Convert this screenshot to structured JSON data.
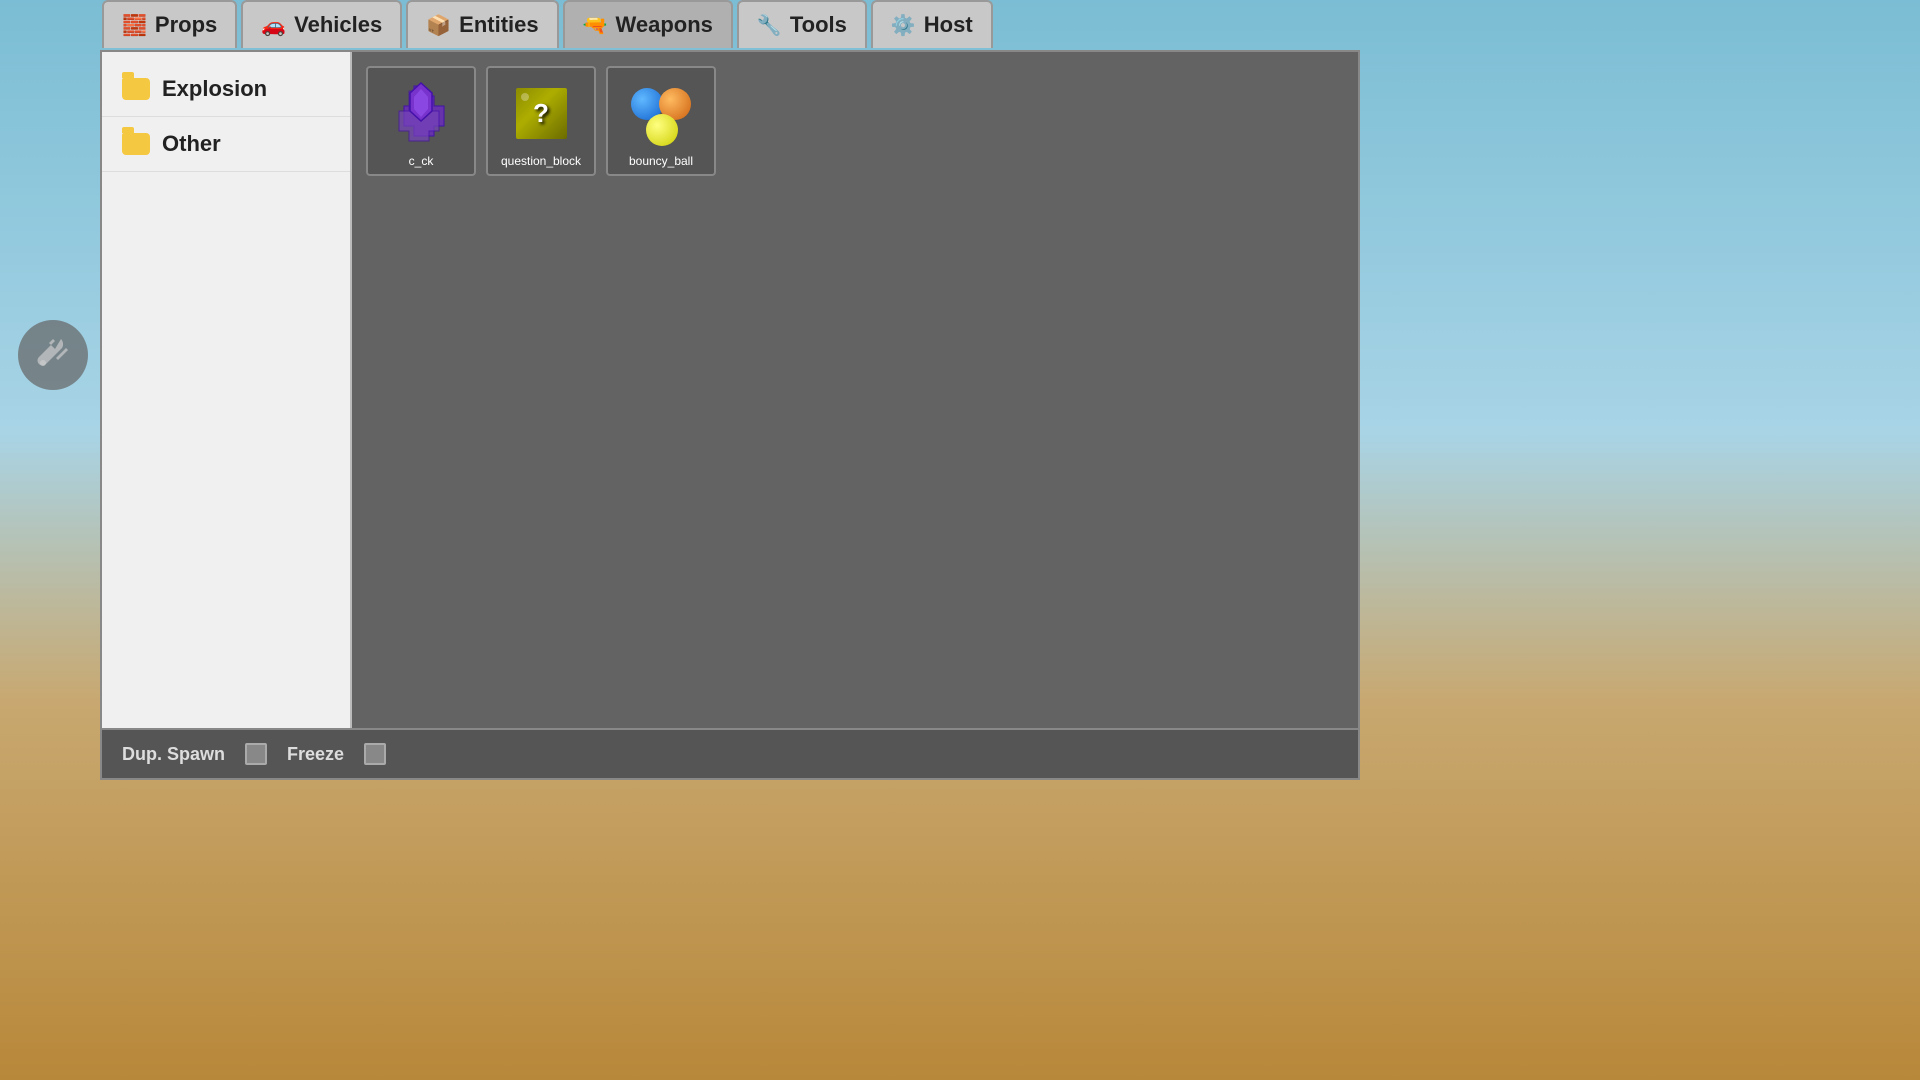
{
  "tabs": [
    {
      "id": "props",
      "label": "Props",
      "icon": "🧱"
    },
    {
      "id": "vehicles",
      "label": "Vehicles",
      "icon": "🚗"
    },
    {
      "id": "entities",
      "label": "Entities",
      "icon": "📦"
    },
    {
      "id": "weapons",
      "label": "Weapons",
      "icon": "🔫"
    },
    {
      "id": "tools",
      "label": "Tools",
      "icon": "🔧"
    },
    {
      "id": "host",
      "label": "Host",
      "icon": "⚙️"
    }
  ],
  "active_tab": "weapons",
  "sidebar": {
    "items": [
      {
        "id": "explosion",
        "label": "Explosion"
      },
      {
        "id": "other",
        "label": "Other"
      }
    ]
  },
  "content": {
    "items": [
      {
        "id": "c_ck",
        "label": "c_ck",
        "type": "purple_shape"
      },
      {
        "id": "question_block",
        "label": "question_block",
        "type": "qblock"
      },
      {
        "id": "bouncy_ball",
        "label": "bouncy_ball",
        "type": "balls"
      }
    ]
  },
  "bottom_bar": {
    "dup_spawn_label": "Dup. Spawn",
    "freeze_label": "Freeze"
  }
}
